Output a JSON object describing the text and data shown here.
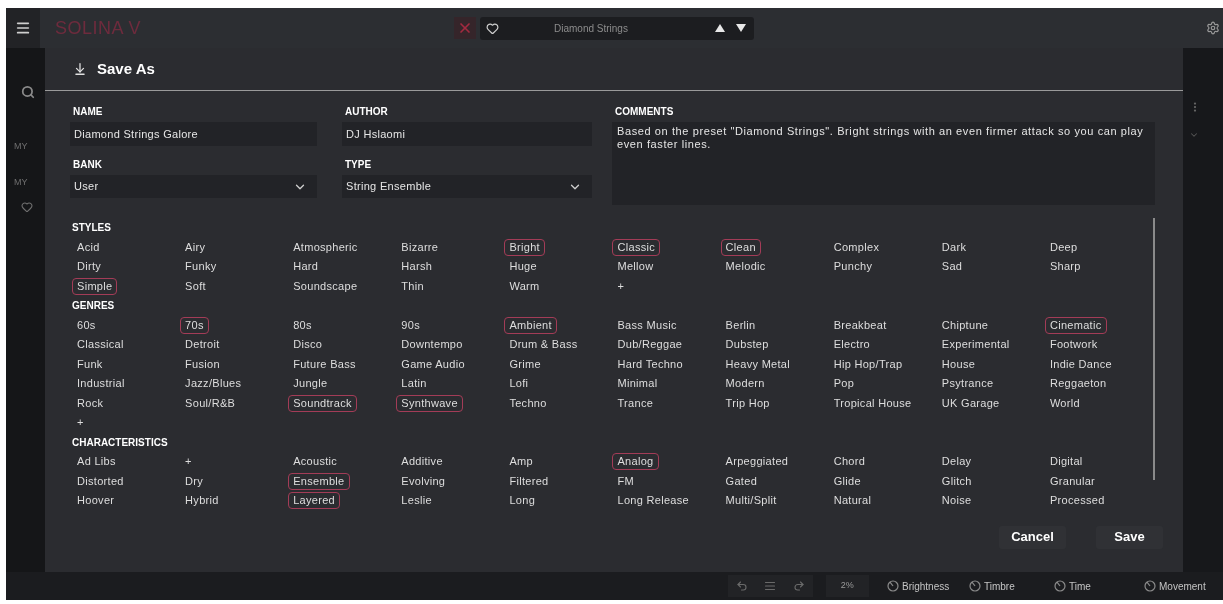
{
  "top_bar": {
    "app_name": "SOLINA V",
    "preset_name": "Diamond Strings"
  },
  "sidebar": {
    "items": [
      {
        "label": "MY"
      },
      {
        "label": "MY"
      }
    ]
  },
  "dialog": {
    "title": "Save As",
    "fields": [
      {
        "kind": "text",
        "label": "NAME",
        "value": "Diamond Strings Galore"
      },
      {
        "kind": "text",
        "label": "AUTHOR",
        "value": "DJ Hslaomi"
      },
      {
        "kind": "select",
        "label": "BANK",
        "value": "User"
      },
      {
        "kind": "select",
        "label": "TYPE",
        "value": "String Ensemble"
      }
    ],
    "comments": {
      "label": "COMMENTS",
      "value": "Based on the preset \"Diamond Strings\". Bright strings with an even firmer attack so you can play even faster lines."
    },
    "sections": [
      {
        "title": "STYLES",
        "tags": [
          {
            "label": "Acid",
            "selected": false
          },
          {
            "label": "Airy",
            "selected": false
          },
          {
            "label": "Atmospheric",
            "selected": false
          },
          {
            "label": "Bizarre",
            "selected": false
          },
          {
            "label": "Bright",
            "selected": true
          },
          {
            "label": "Classic",
            "selected": true
          },
          {
            "label": "Clean",
            "selected": true
          },
          {
            "label": "Complex",
            "selected": false
          },
          {
            "label": "Dark",
            "selected": false
          },
          {
            "label": "Deep",
            "selected": false
          },
          {
            "label": "Dirty",
            "selected": false
          },
          {
            "label": "Funky",
            "selected": false
          },
          {
            "label": "Hard",
            "selected": false
          },
          {
            "label": "Harsh",
            "selected": false
          },
          {
            "label": "Huge",
            "selected": false
          },
          {
            "label": "Mellow",
            "selected": false
          },
          {
            "label": "Melodic",
            "selected": false
          },
          {
            "label": "Punchy",
            "selected": false
          },
          {
            "label": "Sad",
            "selected": false
          },
          {
            "label": "Sharp",
            "selected": false
          },
          {
            "label": "Simple",
            "selected": true
          },
          {
            "label": "Soft",
            "selected": false
          },
          {
            "label": "Soundscape",
            "selected": false
          },
          {
            "label": "Thin",
            "selected": false
          },
          {
            "label": "Warm",
            "selected": false
          },
          {
            "label": "+",
            "selected": false
          }
        ]
      },
      {
        "title": "GENRES",
        "tags": [
          {
            "label": "60s",
            "selected": false
          },
          {
            "label": "70s",
            "selected": true
          },
          {
            "label": "80s",
            "selected": false
          },
          {
            "label": "90s",
            "selected": false
          },
          {
            "label": "Ambient",
            "selected": true
          },
          {
            "label": "Bass Music",
            "selected": false
          },
          {
            "label": "Berlin",
            "selected": false
          },
          {
            "label": "Breakbeat",
            "selected": false
          },
          {
            "label": "Chiptune",
            "selected": false
          },
          {
            "label": "Cinematic",
            "selected": true
          },
          {
            "label": "Classical",
            "selected": false
          },
          {
            "label": "Detroit",
            "selected": false
          },
          {
            "label": "Disco",
            "selected": false
          },
          {
            "label": "Downtempo",
            "selected": false
          },
          {
            "label": "Drum & Bass",
            "selected": false
          },
          {
            "label": "Dub/Reggae",
            "selected": false
          },
          {
            "label": "Dubstep",
            "selected": false
          },
          {
            "label": "Electro",
            "selected": false
          },
          {
            "label": "Experimental",
            "selected": false
          },
          {
            "label": "Footwork",
            "selected": false
          },
          {
            "label": "Funk",
            "selected": false
          },
          {
            "label": "Fusion",
            "selected": false
          },
          {
            "label": "Future Bass",
            "selected": false
          },
          {
            "label": "Game Audio",
            "selected": false
          },
          {
            "label": "Grime",
            "selected": false
          },
          {
            "label": "Hard Techno",
            "selected": false
          },
          {
            "label": "Heavy Metal",
            "selected": false
          },
          {
            "label": "Hip Hop/Trap",
            "selected": false
          },
          {
            "label": "House",
            "selected": false
          },
          {
            "label": "Indie Dance",
            "selected": false
          },
          {
            "label": "Industrial",
            "selected": false
          },
          {
            "label": "Jazz/Blues",
            "selected": false
          },
          {
            "label": "Jungle",
            "selected": false
          },
          {
            "label": "Latin",
            "selected": false
          },
          {
            "label": "Lofi",
            "selected": false
          },
          {
            "label": "Minimal",
            "selected": false
          },
          {
            "label": "Modern",
            "selected": false
          },
          {
            "label": "Pop",
            "selected": false
          },
          {
            "label": "Psytrance",
            "selected": false
          },
          {
            "label": "Reggaeton",
            "selected": false
          },
          {
            "label": "Rock",
            "selected": false
          },
          {
            "label": "Soul/R&B",
            "selected": false
          },
          {
            "label": "Soundtrack",
            "selected": true
          },
          {
            "label": "Synthwave",
            "selected": true
          },
          {
            "label": "Techno",
            "selected": false
          },
          {
            "label": "Trance",
            "selected": false
          },
          {
            "label": "Trip Hop",
            "selected": false
          },
          {
            "label": "Tropical House",
            "selected": false
          },
          {
            "label": "UK Garage",
            "selected": false
          },
          {
            "label": "World",
            "selected": false
          },
          {
            "label": "+",
            "selected": false
          }
        ]
      },
      {
        "title": "CHARACTERISTICS",
        "tags": [
          {
            "label": "Ad Libs",
            "selected": false
          },
          {
            "label": "+",
            "selected": false
          },
          {
            "label": "Acoustic",
            "selected": false
          },
          {
            "label": "Additive",
            "selected": false
          },
          {
            "label": "Amp",
            "selected": false
          },
          {
            "label": "Analog",
            "selected": true
          },
          {
            "label": "Arpeggiated",
            "selected": false
          },
          {
            "label": "Chord",
            "selected": false
          },
          {
            "label": "Delay",
            "selected": false
          },
          {
            "label": "Digital",
            "selected": false
          },
          {
            "label": "Distorted",
            "selected": false
          },
          {
            "label": "Dry",
            "selected": false
          },
          {
            "label": "Ensemble",
            "selected": true
          },
          {
            "label": "Evolving",
            "selected": false
          },
          {
            "label": "Filtered",
            "selected": false
          },
          {
            "label": "FM",
            "selected": false
          },
          {
            "label": "Gated",
            "selected": false
          },
          {
            "label": "Glide",
            "selected": false
          },
          {
            "label": "Glitch",
            "selected": false
          },
          {
            "label": "Granular",
            "selected": false
          },
          {
            "label": "Hoover",
            "selected": false
          },
          {
            "label": "Hybrid",
            "selected": false
          },
          {
            "label": "Layered",
            "selected": true
          },
          {
            "label": "Leslie",
            "selected": false
          },
          {
            "label": "Long",
            "selected": false
          },
          {
            "label": "Long Release",
            "selected": false
          },
          {
            "label": "Multi/Split",
            "selected": false
          },
          {
            "label": "Natural",
            "selected": false
          },
          {
            "label": "Noise",
            "selected": false
          },
          {
            "label": "Processed",
            "selected": false
          }
        ]
      }
    ],
    "buttons": [
      {
        "label": "Cancel"
      },
      {
        "label": "Save"
      }
    ]
  },
  "bottom_bar": {
    "zoom": "2%",
    "macros": [
      {
        "label": "Brightness"
      },
      {
        "label": "Timbre"
      },
      {
        "label": "Time"
      },
      {
        "label": "Movement"
      }
    ]
  }
}
